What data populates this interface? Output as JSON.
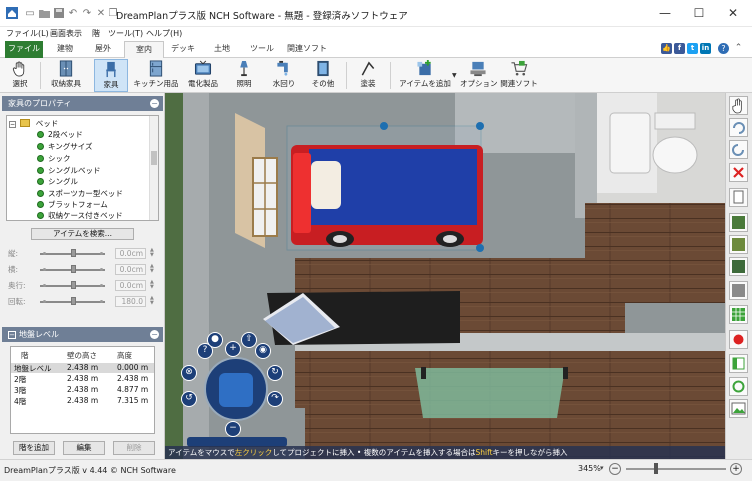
{
  "window": {
    "title": "DreamPlanプラス版 NCH Software - 無題 - 登録済みソフトウェア"
  },
  "menu": [
    "ファイル(L)",
    "画面表示",
    "階",
    "ツール(T)",
    "ヘルプ(H)"
  ],
  "tabs": [
    "ファイル",
    "建物",
    "屋外",
    "室内",
    "デッキ",
    "土地",
    "ツール",
    "関連ソフト"
  ],
  "active_tab": "室内",
  "social": [
    "f",
    "t",
    "in"
  ],
  "toolbar": {
    "items": [
      {
        "label": "選択",
        "icon": "hand-icon"
      },
      {
        "label": "収納家具",
        "icon": "cabinet-icon"
      },
      {
        "label": "家具",
        "icon": "chair-icon"
      },
      {
        "label": "キッチン用品",
        "icon": "kitchen-icon"
      },
      {
        "label": "電化製品",
        "icon": "tv-icon"
      },
      {
        "label": "照明",
        "icon": "lamp-icon"
      },
      {
        "label": "水回り",
        "icon": "faucet-icon"
      },
      {
        "label": "その他",
        "icon": "frame-icon"
      },
      {
        "label": "塗装",
        "icon": "paint-roller-icon"
      },
      {
        "label": "アイテムを追加",
        "icon": "add-item-icon"
      },
      {
        "label": "オプション",
        "icon": "options-icon"
      },
      {
        "label": "関連ソフト",
        "icon": "cart-icon"
      }
    ],
    "selected": "家具"
  },
  "properties_panel": {
    "title": "家具のプロパティ",
    "tree": {
      "root": "ベッド",
      "items": [
        "2段ベッド",
        "キングサイズ",
        "シック",
        "シングルベッド",
        "シングル",
        "スポーツカー型ベッド",
        "ブラットフォーム",
        "収納ケース付きベッド"
      ]
    },
    "search_button": "アイテムを検索...",
    "props": [
      {
        "label": "縦:",
        "value": "0.0cm",
        "slider": 0.5
      },
      {
        "label": "横:",
        "value": "0.0cm",
        "slider": 0.5
      },
      {
        "label": "奥行:",
        "value": "0.0cm",
        "slider": 0.5
      },
      {
        "label": "回転:",
        "value": "180.0",
        "slider": 0.5
      }
    ]
  },
  "levels_panel": {
    "title": "地盤レベル",
    "headers": [
      "階",
      "壁の高さ",
      "高度"
    ],
    "rows": [
      [
        "地盤レベル",
        "2.438 m",
        "0.000 m"
      ],
      [
        "2階",
        "2.438 m",
        "2.438 m"
      ],
      [
        "3階",
        "2.438 m",
        "4.877 m"
      ],
      [
        "4階",
        "2.438 m",
        "7.315 m"
      ]
    ],
    "buttons": [
      "階を追加",
      "編集",
      "削除"
    ]
  },
  "hint": {
    "part1": "アイテムをマウスで",
    "click": "左クリック",
    "part2": "してプロジェクトに挿入 • 複数のアイテムを挿入する場合は",
    "shift": "Shift",
    "part3": "キーを押しながら挿入"
  },
  "status": {
    "version": "DreamPlanプラス版 v 4.44 © NCH Software",
    "zoom": "345%"
  }
}
